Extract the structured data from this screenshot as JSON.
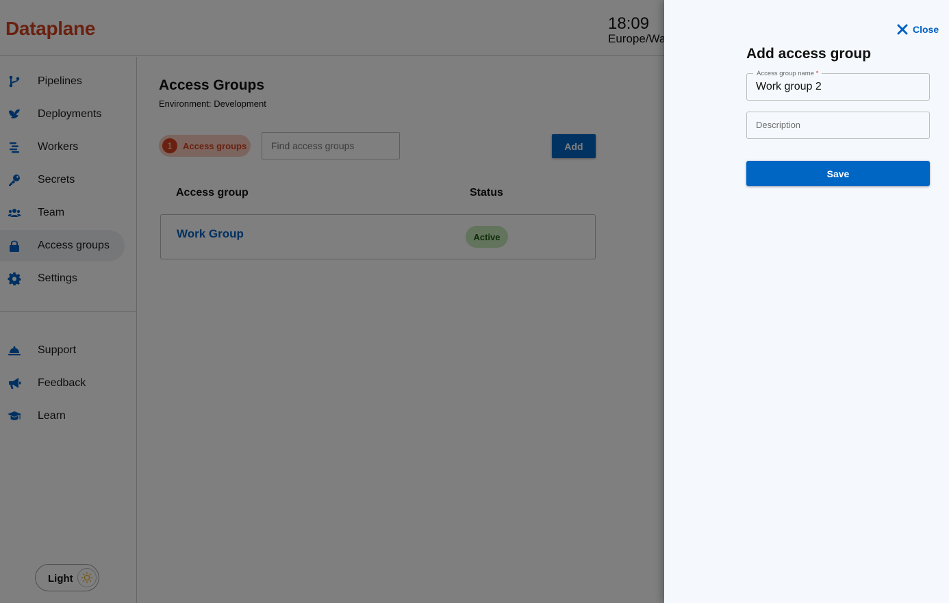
{
  "app": {
    "logo": "Dataplane"
  },
  "clock": {
    "time": "18:09",
    "zone": "Europe/Wa"
  },
  "sidebar": {
    "items": [
      {
        "label": "Pipelines",
        "icon": "pipelines-icon",
        "active": false
      },
      {
        "label": "Deployments",
        "icon": "deployments-icon",
        "active": false
      },
      {
        "label": "Workers",
        "icon": "workers-icon",
        "active": false
      },
      {
        "label": "Secrets",
        "icon": "key-icon",
        "active": false
      },
      {
        "label": "Team",
        "icon": "team-icon",
        "active": false
      },
      {
        "label": "Access groups",
        "icon": "lock-icon",
        "active": true
      },
      {
        "label": "Settings",
        "icon": "gear-icon",
        "active": false
      }
    ],
    "bottom_items": [
      {
        "label": "Support",
        "icon": "bell-icon"
      },
      {
        "label": "Feedback",
        "icon": "megaphone-icon"
      },
      {
        "label": "Learn",
        "icon": "graduation-cap-icon"
      }
    ],
    "theme_toggle": {
      "label": "Light",
      "icon": "sun-icon"
    }
  },
  "main": {
    "title": "Access Groups",
    "environment": "Environment: Development",
    "count_chip": {
      "count": "1",
      "label": "Access groups"
    },
    "search": {
      "placeholder": "Find access groups",
      "value": ""
    },
    "add_label": "Add",
    "columns": [
      "Access group",
      "Status"
    ],
    "rows": [
      {
        "name": "Work Group",
        "status": "Active"
      }
    ]
  },
  "drawer": {
    "close_label": "Close",
    "title": "Add access group",
    "name_field": {
      "label": "Access group name",
      "required_mark": "*",
      "value": "Work group 2"
    },
    "description_field": {
      "placeholder": "Description",
      "value": ""
    },
    "save_label": "Save"
  },
  "colors": {
    "brand": "#d4411e",
    "primary": "#0066c4",
    "link": "#0061c2",
    "status_active_bg": "#c5e8b8",
    "drawer_bg": "#f5f9fd"
  }
}
